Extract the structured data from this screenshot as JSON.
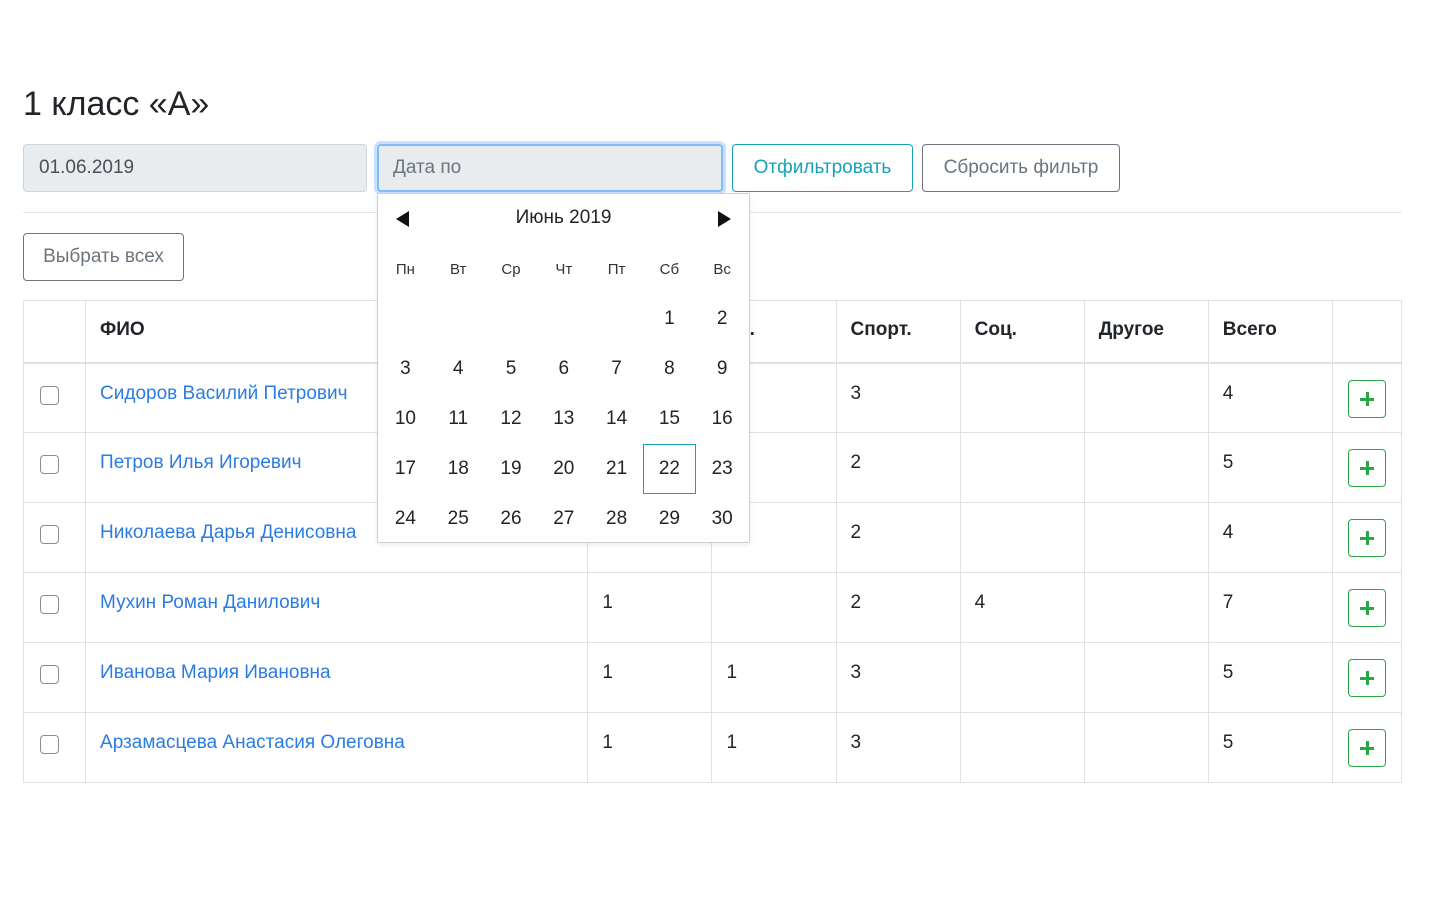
{
  "page": {
    "title": "1 класс «А»"
  },
  "filter": {
    "date_from_value": "01.06.2019",
    "date_to_placeholder": "Дата по",
    "filter_button": "Отфильтровать",
    "reset_button": "Сбросить фильтр"
  },
  "select_all_button": "Выбрать всех",
  "table": {
    "headers": [
      "",
      "ФИО",
      "",
      "Тр.",
      "Спорт.",
      "Соц.",
      "Другое",
      "Всего",
      ""
    ],
    "header_visible_fragment": "ор.",
    "rows": [
      {
        "name": "Сидоров Василий Петрович",
        "c1": "",
        "c2": "",
        "sport": "3",
        "soc": "",
        "other": "",
        "total": "4"
      },
      {
        "name": "Петров Илья Игоревич",
        "c1": "",
        "c2": "",
        "sport": "2",
        "soc": "",
        "other": "",
        "total": "5"
      },
      {
        "name": "Николаева Дарья Денисовна",
        "c1": "",
        "c2": "",
        "sport": "2",
        "soc": "",
        "other": "",
        "total": "4"
      },
      {
        "name": "Мухин Роман Данилович",
        "c1": "1",
        "c2": "",
        "sport": "2",
        "soc": "4",
        "other": "",
        "total": "7"
      },
      {
        "name": "Иванова Мария Ивановна",
        "c1": "1",
        "c2": "1",
        "sport": "3",
        "soc": "",
        "other": "",
        "total": "5"
      },
      {
        "name": "Арзамасцева Анастасия Олеговна",
        "c1": "1",
        "c2": "1",
        "sport": "3",
        "soc": "",
        "other": "",
        "total": "5"
      }
    ]
  },
  "datepicker": {
    "month_label": "Июнь 2019",
    "weekdays": [
      "Пн",
      "Вт",
      "Ср",
      "Чт",
      "Пт",
      "Сб",
      "Вс"
    ],
    "weeks": [
      [
        "",
        "",
        "",
        "",
        "",
        "1",
        "2"
      ],
      [
        "3",
        "4",
        "5",
        "6",
        "7",
        "8",
        "9"
      ],
      [
        "10",
        "11",
        "12",
        "13",
        "14",
        "15",
        "16"
      ],
      [
        "17",
        "18",
        "19",
        "20",
        "21",
        "22",
        "23"
      ],
      [
        "24",
        "25",
        "26",
        "27",
        "28",
        "29",
        "30"
      ]
    ],
    "highlighted_day": "22"
  }
}
